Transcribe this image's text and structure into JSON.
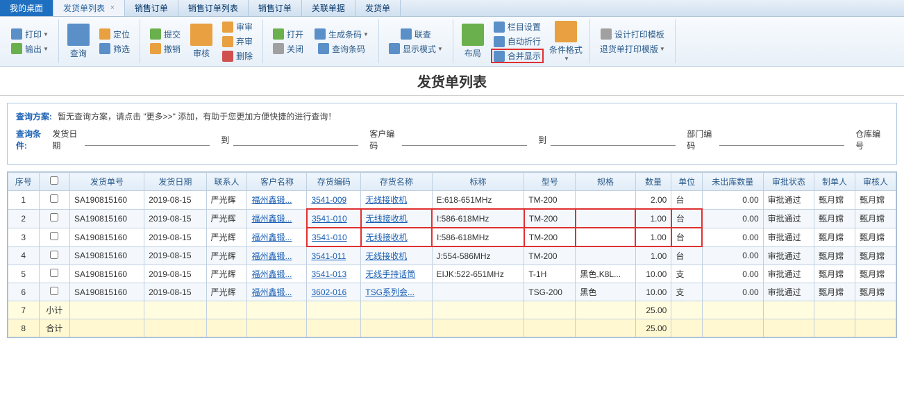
{
  "tabs": [
    "我的桌面",
    "发货单列表",
    "销售订单",
    "销售订单列表",
    "销售订单",
    "关联单据",
    "发货单"
  ],
  "toolbar": {
    "print": "打印",
    "export": "输出",
    "search": "查询",
    "locate": "定位",
    "filter": "筛选",
    "submit": "提交",
    "revoke": "撤销",
    "audit_big": "审核",
    "audit": "审审",
    "unaudit": "弃审",
    "delete": "删除",
    "open": "打开",
    "close": "关闭",
    "gencode": "生成条码",
    "querycode": "查询条码",
    "linkcheck": "联查",
    "dispmode": "显示模式",
    "layout": "布局",
    "colset": "栏目设置",
    "autowrap": "自动折行",
    "merge": "合并显示",
    "condfmt": "条件格式",
    "tmpldesign": "设计打印模板",
    "returntmpl": "退货单打印模版"
  },
  "title": "发货单列表",
  "query": {
    "scheme_label": "查询方案:",
    "scheme_text": "暂无查询方案，请点击 \"更多>>\" 添加，有助于您更加方便快捷的进行查询！",
    "cond_label": "查询条件:",
    "f1": "发货日期",
    "f_to": "到",
    "f2": "客户编码",
    "f3": "到",
    "f4": "部门编码",
    "f5": "仓库编号"
  },
  "columns": [
    "序号",
    "",
    "发货单号",
    "发货日期",
    "联系人",
    "客户名称",
    "存货编码",
    "存货名称",
    "标称",
    "型号",
    "规格",
    "数量",
    "单位",
    "未出库数量",
    "审批状态",
    "制单人",
    "审核人"
  ],
  "rows": [
    {
      "seq": "1",
      "no": "SA190815160",
      "date": "2019-08-15",
      "contact": "严光辉",
      "cust": "福州鑫锻...",
      "code": "3541-009",
      "name": "无线接收机",
      "spec": "E:618-651MHz",
      "model": "TM-200",
      "std": "",
      "qty": "2.00",
      "unit": "台",
      "pend": "0.00",
      "status": "审批通过",
      "maker": "甄月嫦",
      "auditor": "甄月嫦"
    },
    {
      "seq": "2",
      "no": "SA190815160",
      "date": "2019-08-15",
      "contact": "严光辉",
      "cust": "福州鑫锻...",
      "code": "3541-010",
      "name": "无线接收机",
      "spec": "I:586-618MHz",
      "model": "TM-200",
      "std": "",
      "qty": "1.00",
      "unit": "台",
      "pend": "0.00",
      "status": "审批通过",
      "maker": "甄月嫦",
      "auditor": "甄月嫦"
    },
    {
      "seq": "3",
      "no": "SA190815160",
      "date": "2019-08-15",
      "contact": "严光辉",
      "cust": "福州鑫锻...",
      "code": "3541-010",
      "name": "无线接收机",
      "spec": "I:586-618MHz",
      "model": "TM-200",
      "std": "",
      "qty": "1.00",
      "unit": "台",
      "pend": "0.00",
      "status": "审批通过",
      "maker": "甄月嫦",
      "auditor": "甄月嫦"
    },
    {
      "seq": "4",
      "no": "SA190815160",
      "date": "2019-08-15",
      "contact": "严光辉",
      "cust": "福州鑫锻...",
      "code": "3541-011",
      "name": "无线接收机",
      "spec": "J:554-586MHz",
      "model": "TM-200",
      "std": "",
      "qty": "1.00",
      "unit": "台",
      "pend": "0.00",
      "status": "审批通过",
      "maker": "甄月嫦",
      "auditor": "甄月嫦"
    },
    {
      "seq": "5",
      "no": "SA190815160",
      "date": "2019-08-15",
      "contact": "严光辉",
      "cust": "福州鑫锻...",
      "code": "3541-013",
      "name": "无线手持话筒",
      "spec": "EIJK:522-651MHz",
      "model": "T-1H",
      "std": "黑色,K8L...",
      "qty": "10.00",
      "unit": "支",
      "pend": "0.00",
      "status": "审批通过",
      "maker": "甄月嫦",
      "auditor": "甄月嫦"
    },
    {
      "seq": "6",
      "no": "SA190815160",
      "date": "2019-08-15",
      "contact": "严光辉",
      "cust": "福州鑫锻...",
      "code": "3602-016",
      "name": "TSG系列会...",
      "spec": "",
      "model": "TSG-200",
      "std": "黑色",
      "qty": "10.00",
      "unit": "支",
      "pend": "0.00",
      "status": "审批通过",
      "maker": "甄月嫦",
      "auditor": "甄月嫦"
    }
  ],
  "subtotal": {
    "seq": "7",
    "label": "小计",
    "qty": "25.00"
  },
  "total": {
    "seq": "8",
    "label": "合计",
    "qty": "25.00"
  }
}
